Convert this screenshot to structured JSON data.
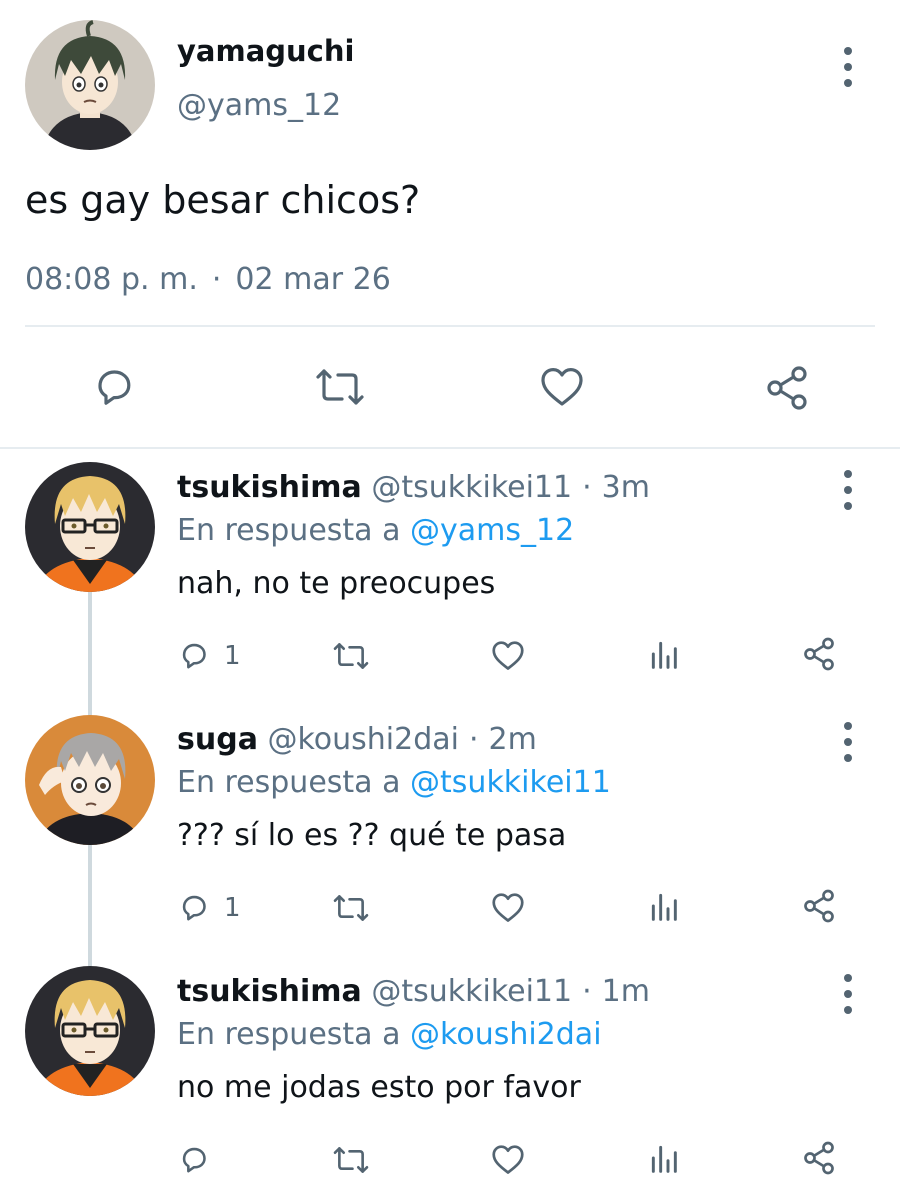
{
  "main_tweet": {
    "author_name": "yamaguchi",
    "author_handle": "@yams_12",
    "avatar": "yamaguchi-anime-avatar",
    "text": "es gay besar chicos?",
    "time": "08:08 p. m.",
    "meta_separator": "·",
    "date": "02 mar 26",
    "actions": [
      "reply-icon",
      "retweet-icon",
      "like-icon",
      "share-icon"
    ]
  },
  "reply_prefix": "En respuesta a",
  "replies": [
    {
      "name": "tsukishima",
      "handle": "@tsukkikei11",
      "separator": "·",
      "time": "3m",
      "reply_to": "@yams_12",
      "text": "nah, no te preocupes",
      "reply_count": "1",
      "avatar": "tsukishima-anime-avatar"
    },
    {
      "name": "suga",
      "handle": "@koushi2dai",
      "separator": "·",
      "time": "2m",
      "reply_to": "@tsukkikei11",
      "text": "??? sí lo es ?? qué te pasa",
      "reply_count": "1",
      "avatar": "suga-anime-avatar"
    },
    {
      "name": "tsukishima",
      "handle": "@tsukkikei11",
      "separator": "·",
      "time": "1m",
      "reply_to": "@koushi2dai",
      "text": "no me jodas esto por favor",
      "reply_count": "",
      "avatar": "tsukishima-anime-avatar"
    }
  ],
  "colors": {
    "text": "#0f1419",
    "secondary": "#5b7083",
    "mention": "#1d9bf0",
    "divider": "#e6ecf0",
    "icon": "#536471"
  }
}
